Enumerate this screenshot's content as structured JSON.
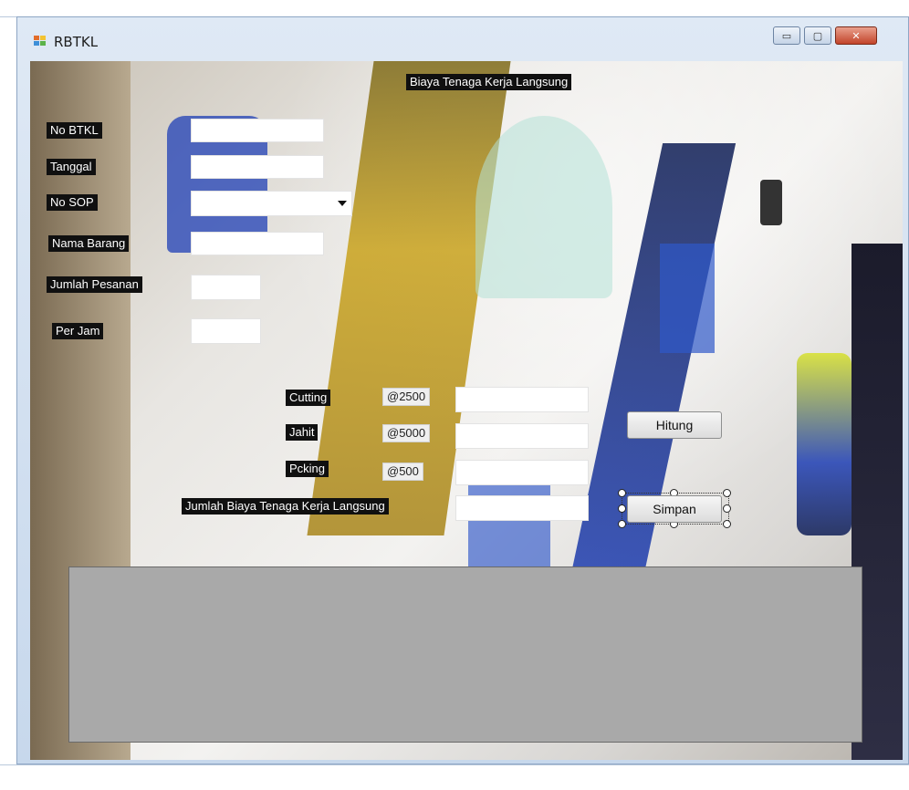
{
  "window": {
    "title": "RBTKL",
    "controls": {
      "minimize": "▭",
      "maximize": "▢",
      "close": "✕"
    }
  },
  "form": {
    "heading": "Biaya Tenaga Kerja Langsung",
    "labels": {
      "no_btkl": "No BTKL",
      "tanggal": "Tanggal",
      "no_sop": "No SOP",
      "nama_barang": "Nama Barang",
      "jumlah_pesanan": "Jumlah Pesanan",
      "per_jam": "Per Jam",
      "cutting": "Cutting",
      "jahit": "Jahit",
      "packing": "Pcking",
      "total": "Jumlah Biaya Tenaga Kerja Langsung"
    },
    "rates": {
      "cutting": "@2500",
      "jahit": "@5000",
      "packing": "@500"
    },
    "values": {
      "no_btkl": "",
      "tanggal": "",
      "no_sop": "",
      "nama_barang": "",
      "jumlah_pesanan": "",
      "per_jam": "",
      "cutting": "",
      "jahit": "",
      "packing": "",
      "total": ""
    },
    "buttons": {
      "hitung": "Hitung",
      "simpan": "Simpan"
    }
  },
  "colors": {
    "label_bg": "#101010",
    "grid_bg": "#a9a9a9",
    "accent_blue": "#1f3fb5",
    "accent_yellow": "#c9a21c"
  }
}
